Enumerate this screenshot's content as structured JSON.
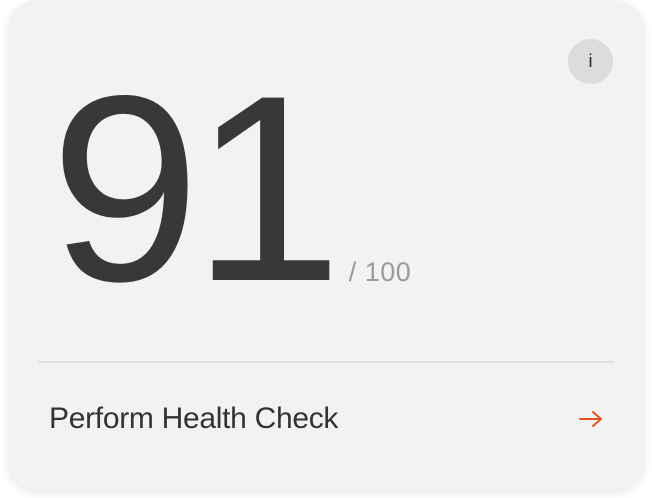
{
  "card": {
    "info_button_label": "i",
    "score": {
      "value": "91",
      "max": "/ 100"
    },
    "action": {
      "label": "Perform Health Check",
      "icon": "arrow-right-icon"
    }
  },
  "colors": {
    "card_background": "#f2f2f1",
    "score_text": "#383838",
    "muted_text": "#9b9b9b",
    "accent": "#e0522b",
    "info_button_bg": "#dcdcdc"
  }
}
